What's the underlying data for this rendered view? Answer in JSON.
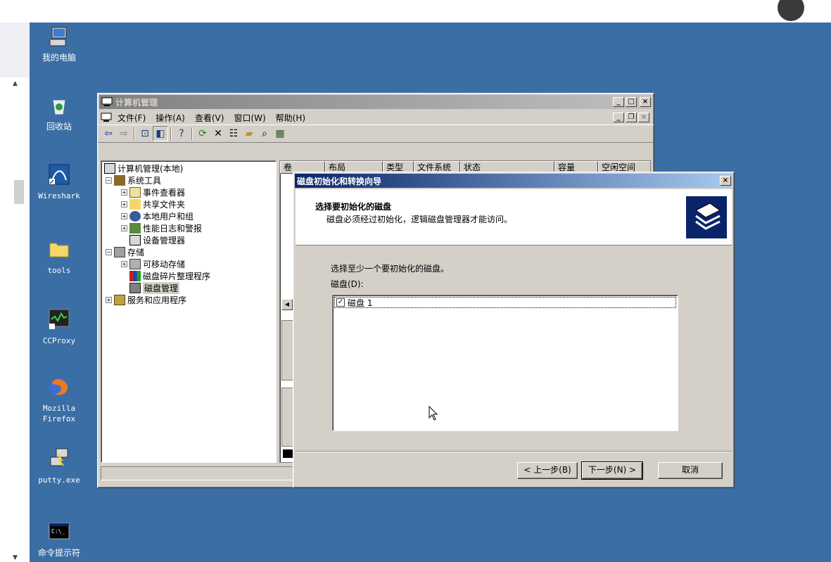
{
  "desktop": {
    "icons": [
      {
        "label": "我的电脑"
      },
      {
        "label": "回收站"
      },
      {
        "label": "Wireshark"
      },
      {
        "label": "tools"
      },
      {
        "label": "CCProxy"
      },
      {
        "label": "Mozilla Firefox"
      },
      {
        "label": "putty.exe"
      },
      {
        "label": "命令提示符"
      }
    ]
  },
  "mmc": {
    "title": "计算机管理",
    "menu": [
      "文件(F)",
      "操作(A)",
      "查看(V)",
      "窗口(W)",
      "帮助(H)"
    ],
    "tree": [
      {
        "label": "计算机管理(本地)"
      },
      {
        "label": "系统工具"
      },
      {
        "label": "事件查看器"
      },
      {
        "label": "共享文件夹"
      },
      {
        "label": "本地用户和组"
      },
      {
        "label": "性能日志和警报"
      },
      {
        "label": "设备管理器"
      },
      {
        "label": "存储"
      },
      {
        "label": "可移动存储"
      },
      {
        "label": "磁盘碎片整理程序"
      },
      {
        "label": "磁盘管理"
      },
      {
        "label": "服务和应用程序"
      }
    ],
    "columns": [
      "卷",
      "布局",
      "类型",
      "文件系统",
      "状态",
      "容量",
      "空闲空间"
    ]
  },
  "wizard": {
    "title": "磁盘初始化和转换向导",
    "header_title": "选择要初始化的磁盘",
    "header_subtitle": "磁盘必须经过初始化，逻辑磁盘管理器才能访问。",
    "prompt": "选择至少一个要初始化的磁盘。",
    "list_label": "磁盘(D):",
    "disks": [
      {
        "label": "磁盘 1",
        "checked": true
      }
    ],
    "buttons": {
      "back": "< 上一步(B)",
      "next": "下一步(N) >",
      "cancel": "取消"
    }
  }
}
